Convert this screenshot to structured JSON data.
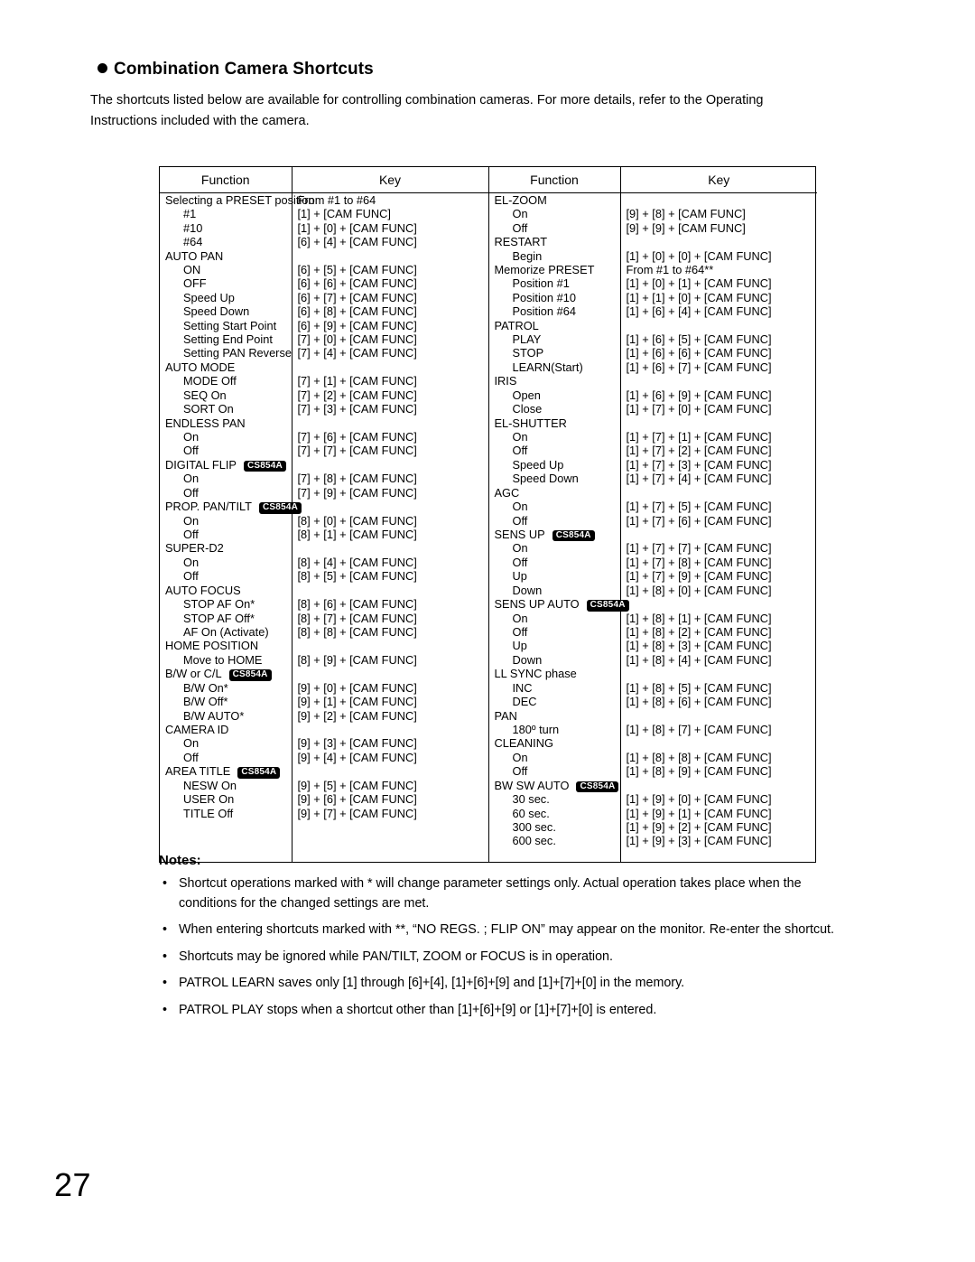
{
  "heading": "Combination Camera Shortcuts",
  "intro": {
    "line1": "The shortcuts listed below are available for controlling combination cameras. For more details, refer to the Operating",
    "line2": "Instructions included with the camera."
  },
  "table": {
    "headers": [
      "Function",
      "Key",
      "Function",
      "Key"
    ],
    "left_rows": [
      {
        "func": "Selecting a PRESET position",
        "key": "From #1 to #64",
        "indent": 0,
        "wide": true
      },
      {
        "func": "#1",
        "key": "[1] + [CAM FUNC]",
        "indent": 1
      },
      {
        "func": "#10",
        "key": "[1] + [0] + [CAM FUNC]",
        "indent": 1
      },
      {
        "func": "#64",
        "key": "[6] + [4] + [CAM FUNC]",
        "indent": 1
      },
      {
        "func": "AUTO PAN",
        "key": "",
        "indent": 0
      },
      {
        "func": "ON",
        "key": "[6] + [5] + [CAM FUNC]",
        "indent": 1
      },
      {
        "func": "OFF",
        "key": "[6] + [6] + [CAM FUNC]",
        "indent": 1
      },
      {
        "func": "Speed Up",
        "key": "[6] + [7] + [CAM FUNC]",
        "indent": 1
      },
      {
        "func": "Speed Down",
        "key": "[6] + [8] + [CAM FUNC]",
        "indent": 1
      },
      {
        "func": "Setting Start Point",
        "key": "[6] + [9] + [CAM FUNC]",
        "indent": 1
      },
      {
        "func": "Setting End Point",
        "key": "[7] + [0] + [CAM FUNC]",
        "indent": 1
      },
      {
        "func": "Setting PAN Reverse",
        "key": "[7] + [4] + [CAM FUNC]",
        "indent": 1
      },
      {
        "func": "AUTO MODE",
        "key": "",
        "indent": 0
      },
      {
        "func": "MODE Off",
        "key": "[7] + [1] + [CAM FUNC]",
        "indent": 1
      },
      {
        "func": "SEQ On",
        "key": "[7] + [2] + [CAM FUNC]",
        "indent": 1
      },
      {
        "func": "SORT On",
        "key": "[7] + [3] + [CAM FUNC]",
        "indent": 1
      },
      {
        "func": "ENDLESS PAN",
        "key": "",
        "indent": 0
      },
      {
        "func": "On",
        "key": "[7] + [6] + [CAM FUNC]",
        "indent": 1
      },
      {
        "func": "Off",
        "key": "[7] + [7] + [CAM FUNC]",
        "indent": 1
      },
      {
        "func": "DIGITAL FLIP",
        "key": "",
        "indent": 0,
        "tag": "CS854A"
      },
      {
        "func": "On",
        "key": "[7] + [8] + [CAM FUNC]",
        "indent": 1
      },
      {
        "func": "Off",
        "key": "[7] + [9] + [CAM FUNC]",
        "indent": 1
      },
      {
        "func": "PROP. PAN/TILT",
        "key": "",
        "indent": 0,
        "tag": "CS854A"
      },
      {
        "func": "On",
        "key": "[8] + [0] + [CAM FUNC]",
        "indent": 1
      },
      {
        "func": "Off",
        "key": "[8] + [1] + [CAM FUNC]",
        "indent": 1
      },
      {
        "func": "SUPER-D2",
        "key": "",
        "indent": 0
      },
      {
        "func": "On",
        "key": "[8] + [4] + [CAM FUNC]",
        "indent": 1
      },
      {
        "func": "Off",
        "key": "[8] + [5] + [CAM FUNC]",
        "indent": 1
      },
      {
        "func": "AUTO FOCUS",
        "key": "",
        "indent": 0
      },
      {
        "func": "STOP AF On*",
        "key": "[8] + [6] + [CAM FUNC]",
        "indent": 1
      },
      {
        "func": "STOP AF Off*",
        "key": "[8] + [7] + [CAM FUNC]",
        "indent": 1
      },
      {
        "func": "AF On (Activate)",
        "key": "[8] + [8] + [CAM FUNC]",
        "indent": 1
      },
      {
        "func": "HOME POSITION",
        "key": "",
        "indent": 0
      },
      {
        "func": "Move to HOME",
        "key": "[8] + [9] + [CAM FUNC]",
        "indent": 1
      },
      {
        "func": "B/W or C/L",
        "key": "",
        "indent": 0,
        "tag": "CS854A"
      },
      {
        "func": "B/W On*",
        "key": "[9] + [0] + [CAM FUNC]",
        "indent": 1
      },
      {
        "func": "B/W Off*",
        "key": "[9] + [1] + [CAM FUNC]",
        "indent": 1
      },
      {
        "func": "B/W AUTO*",
        "key": "[9] + [2] + [CAM FUNC]",
        "indent": 1
      },
      {
        "func": "CAMERA ID",
        "key": "",
        "indent": 0
      },
      {
        "func": "On",
        "key": "[9] + [3] + [CAM FUNC]",
        "indent": 1
      },
      {
        "func": "Off",
        "key": "[9] + [4] + [CAM FUNC]",
        "indent": 1
      },
      {
        "func": "AREA TITLE",
        "key": "",
        "indent": 0,
        "tag": "CS854A"
      },
      {
        "func": "NESW On",
        "key": "[9] + [5] + [CAM FUNC]",
        "indent": 1
      },
      {
        "func": "USER On",
        "key": "[9] + [6] + [CAM FUNC]",
        "indent": 1
      },
      {
        "func": "TITLE Off",
        "key": "[9] + [7] + [CAM FUNC]",
        "indent": 1
      },
      {
        "func": "",
        "key": "",
        "indent": 0
      },
      {
        "func": "",
        "key": "",
        "indent": 0
      },
      {
        "func": "",
        "key": "",
        "indent": 0
      }
    ],
    "right_rows": [
      {
        "func": "EL-ZOOM",
        "key": "",
        "indent": 0
      },
      {
        "func": "On",
        "key": "[9] + [8] + [CAM FUNC]",
        "indent": 1
      },
      {
        "func": "Off",
        "key": "[9] + [9] + [CAM FUNC]",
        "indent": 1
      },
      {
        "func": "RESTART",
        "key": "",
        "indent": 0
      },
      {
        "func": "Begin",
        "key": "[1] + [0] + [0] + [CAM FUNC]",
        "indent": 1
      },
      {
        "func": "Memorize PRESET",
        "key": "From #1 to #64**",
        "indent": 0
      },
      {
        "func": "Position #1",
        "key": "[1] + [0] + [1] + [CAM FUNC]",
        "indent": 1
      },
      {
        "func": "Position #10",
        "key": "[1] + [1] + [0] + [CAM FUNC]",
        "indent": 1
      },
      {
        "func": "Position #64",
        "key": "[1] + [6] + [4] + [CAM FUNC]",
        "indent": 1
      },
      {
        "func": "PATROL",
        "key": "",
        "indent": 0
      },
      {
        "func": "PLAY",
        "key": "[1] + [6] + [5] + [CAM FUNC]",
        "indent": 1
      },
      {
        "func": "STOP",
        "key": "[1] + [6] + [6] + [CAM FUNC]",
        "indent": 1
      },
      {
        "func": "LEARN(Start)",
        "key": "[1] + [6] + [7] + [CAM FUNC]",
        "indent": 1
      },
      {
        "func": "IRIS",
        "key": "",
        "indent": 0
      },
      {
        "func": "Open",
        "key": "[1] + [6] + [9] + [CAM FUNC]",
        "indent": 1
      },
      {
        "func": "Close",
        "key": "[1] + [7] + [0] + [CAM FUNC]",
        "indent": 1
      },
      {
        "func": "EL-SHUTTER",
        "key": "",
        "indent": 0
      },
      {
        "func": "On",
        "key": "[1] + [7] + [1] + [CAM FUNC]",
        "indent": 1
      },
      {
        "func": "Off",
        "key": "[1] + [7] + [2] + [CAM FUNC]",
        "indent": 1
      },
      {
        "func": "Speed Up",
        "key": "[1] + [7] + [3] + [CAM FUNC]",
        "indent": 1
      },
      {
        "func": "Speed Down",
        "key": "[1] + [7] + [4] + [CAM FUNC]",
        "indent": 1
      },
      {
        "func": "AGC",
        "key": "",
        "indent": 0
      },
      {
        "func": "On",
        "key": "[1] + [7] + [5] + [CAM FUNC]",
        "indent": 1
      },
      {
        "func": "Off",
        "key": "[1] + [7] + [6] + [CAM FUNC]",
        "indent": 1
      },
      {
        "func": "SENS UP",
        "key": "",
        "indent": 0,
        "tag": "CS854A"
      },
      {
        "func": "On",
        "key": "[1] + [7] + [7] + [CAM FUNC]",
        "indent": 1
      },
      {
        "func": "Off",
        "key": "[1] + [7] + [8] + [CAM FUNC]",
        "indent": 1
      },
      {
        "func": "Up",
        "key": "[1] + [7] + [9] + [CAM FUNC]",
        "indent": 1
      },
      {
        "func": "Down",
        "key": "[1] + [8] + [0] + [CAM FUNC]",
        "indent": 1
      },
      {
        "func": "SENS UP AUTO",
        "key": "",
        "indent": 0,
        "tag": "CS854A"
      },
      {
        "func": "On",
        "key": "[1] + [8] + [1] + [CAM FUNC]",
        "indent": 1
      },
      {
        "func": "Off",
        "key": "[1] + [8] + [2] + [CAM FUNC]",
        "indent": 1
      },
      {
        "func": "Up",
        "key": "[1] + [8] + [3] + [CAM FUNC]",
        "indent": 1
      },
      {
        "func": "Down",
        "key": "[1] + [8] + [4] + [CAM FUNC]",
        "indent": 1
      },
      {
        "func": "LL SYNC phase",
        "key": "",
        "indent": 0
      },
      {
        "func": "INC",
        "key": "[1] + [8] + [5] + [CAM FUNC]",
        "indent": 1
      },
      {
        "func": "DEC",
        "key": "[1] + [8] + [6] + [CAM FUNC]",
        "indent": 1
      },
      {
        "func": "PAN",
        "key": "",
        "indent": 0
      },
      {
        "func": "180º turn",
        "key": "[1] + [8] + [7] + [CAM FUNC]",
        "indent": 1
      },
      {
        "func": "CLEANING",
        "key": "",
        "indent": 0
      },
      {
        "func": "On",
        "key": "[1] + [8] + [8] + [CAM FUNC]",
        "indent": 1
      },
      {
        "func": "Off",
        "key": "[1] + [8] + [9] + [CAM FUNC]",
        "indent": 1
      },
      {
        "func": "BW SW AUTO",
        "key": "",
        "indent": 0,
        "tag": "CS854A"
      },
      {
        "func": "30 sec.",
        "key": "[1] + [9] + [0] + [CAM FUNC]",
        "indent": 1
      },
      {
        "func": "60 sec.",
        "key": "[1] + [9] + [1] + [CAM FUNC]",
        "indent": 1
      },
      {
        "func": "300 sec.",
        "key": "[1] + [9] + [2] + [CAM FUNC]",
        "indent": 1
      },
      {
        "func": "600 sec.",
        "key": "[1] + [9] + [3] + [CAM FUNC]",
        "indent": 1
      },
      {
        "func": "",
        "key": "",
        "indent": 0
      }
    ]
  },
  "notes": {
    "title": "Notes:",
    "items": [
      "Shortcut operations marked with * will change parameter settings only. Actual operation takes place when the conditions for the changed settings are met.",
      "When entering shortcuts marked with **, “NO REGS. ; FLIP ON” may appear on the monitor. Re-enter the shortcut.",
      "Shortcuts may be ignored while PAN/TILT, ZOOM or FOCUS is in operation.",
      "PATROL LEARN saves only [1] through [6]+[4], [1]+[6]+[9] and [1]+[7]+[0] in the memory.",
      "PATROL PLAY stops when a shortcut other than [1]+[6]+[9] or [1]+[7]+[0] is entered."
    ]
  },
  "page_number": "27"
}
